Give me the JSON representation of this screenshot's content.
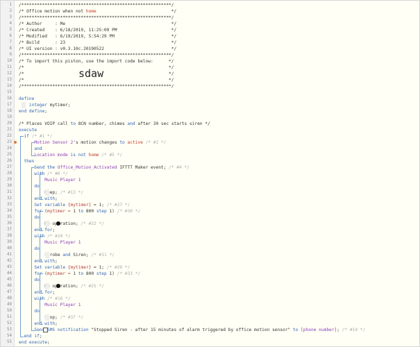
{
  "big_title": "sdaw",
  "lines": [
    {
      "n": "1",
      "t": "/**********************************************************/"
    },
    {
      "n": "2",
      "t": "/* Office motion when not home                             */"
    },
    {
      "n": "3",
      "t": "/**********************************************************/"
    },
    {
      "n": "4",
      "t": "/* Author     : Me                                         */"
    },
    {
      "n": "5",
      "t": "/* Created    : 6/18/2019, 11:25:09 PM                     */"
    },
    {
      "n": "6",
      "t": "/* Modified   : 6/19/2019, 5:54:29 PM                      */"
    },
    {
      "n": "7",
      "t": "/* Build      : 23                                         */"
    },
    {
      "n": "8",
      "t": "/* UI version : v0.3.10c.20190522                          */"
    },
    {
      "n": "9",
      "t": "/**********************************************************/"
    },
    {
      "n": "10",
      "t": "/* To import this piston, use the import code below:      */"
    },
    {
      "n": "11",
      "t": "/*                                                        */"
    },
    {
      "n": "12",
      "t": "/*                                                        */"
    },
    {
      "n": "13",
      "t": "/*                                                        */"
    },
    {
      "n": "14",
      "t": "/**********************************************************/"
    },
    {
      "n": "15",
      "t": ""
    },
    {
      "n": "16",
      "t": "define"
    },
    {
      "n": "17",
      "t": "    integer mytimer;"
    },
    {
      "n": "18",
      "t": "end define;"
    },
    {
      "n": "19",
      "t": ""
    },
    {
      "n": "20",
      "t": "/* Places VOIP call to 8CN number, chimes and after 30 sec starts siren */"
    },
    {
      "n": "21",
      "t": "execute"
    },
    {
      "n": "22",
      "t": "  if /* #1 */"
    },
    {
      "n": "23",
      "t": "      Motion Sensor 2's motion changes to active /* #2 */"
    },
    {
      "n": "24",
      "t": "      and"
    },
    {
      "n": "25",
      "t": "      Location mode is not home /* #5 */"
    },
    {
      "n": "26",
      "t": "  then"
    },
    {
      "n": "27",
      "t": "      Send the Office_Motion_Activated IFTTT Maker event; /* #4 */"
    },
    {
      "n": "28",
      "t": "      with /* #6 */"
    },
    {
      "n": "29",
      "t": "          Music Player 1"
    },
    {
      "n": "30",
      "t": "      do"
    },
    {
      "n": "31",
      "t": "          Beep; /* #13 */"
    },
    {
      "n": "32",
      "t": "      end with;"
    },
    {
      "n": "33",
      "t": "      Set variable {mytimer} = 1; /* #27 */"
    },
    {
      "n": "34",
      "t": "      for (mytimer = 1 to 800 step 1) /* #30 */"
    },
    {
      "n": "35",
      "t": "      do"
    },
    {
      "n": "36",
      "t": "          No operation; /* #32 */"
    },
    {
      "n": "37",
      "t": "      end for;"
    },
    {
      "n": "38",
      "t": "      with /* #10 */"
    },
    {
      "n": "39",
      "t": "          Music Player 1"
    },
    {
      "n": "40",
      "t": "      do"
    },
    {
      "n": "41",
      "t": "          Strobe and Siren; /* #11 */"
    },
    {
      "n": "42",
      "t": "      end with;"
    },
    {
      "n": "43",
      "t": "      Set variable {mytimer} = 1; /* #29 */"
    },
    {
      "n": "44",
      "t": "      for (mytimer = 1 to 800 step 1) /* #33 */"
    },
    {
      "n": "45",
      "t": "      do"
    },
    {
      "n": "46",
      "t": "          No operation; /* #25 */"
    },
    {
      "n": "47",
      "t": "      end for;"
    },
    {
      "n": "48",
      "t": "      with /* #16 */"
    },
    {
      "n": "49",
      "t": "          Music Player 1"
    },
    {
      "n": "50",
      "t": "      do"
    },
    {
      "n": "51",
      "t": "          Stop; /* #37 */"
    },
    {
      "n": "52",
      "t": "      end with;"
    },
    {
      "n": "53",
      "t": "      Send SMS notification \"Stopped Siren - after 15 minutes of alarm triggered by office motion sensor\" to [phone number]; /* #19 */"
    },
    {
      "n": "54",
      "t": "  end if;"
    },
    {
      "n": "55",
      "t": "end execute;"
    }
  ],
  "colors": {
    "keyword": "#2f63b8",
    "device": "#8a3ab9",
    "variable": "#b33c3c",
    "comment": "#aaaaaa",
    "bracket": "#5b9bd5"
  }
}
